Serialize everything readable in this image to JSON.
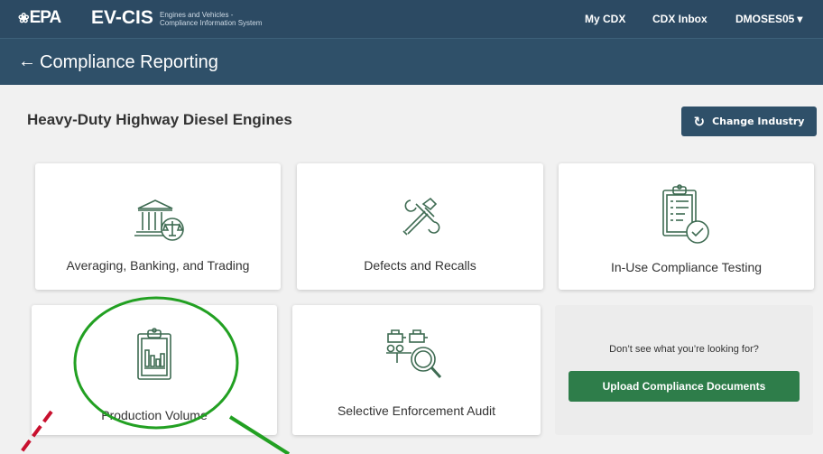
{
  "header": {
    "logo_text": "EPA",
    "logo_mark": "❀",
    "app_name": "EV-CIS",
    "app_subtitle_line1": "Engines and Vehicles -",
    "app_subtitle_line2": "Compliance Information System",
    "nav": {
      "my_cdx": "My CDX",
      "cdx_inbox": "CDX Inbox",
      "user": "DMOSES05",
      "user_caret": "▾"
    }
  },
  "title_bar": {
    "back_icon": "←",
    "title": "Compliance Reporting"
  },
  "section": {
    "title": "Heavy-Duty Highway Diesel Engines",
    "change_industry": {
      "icon": "↻",
      "label": "Change Industry"
    }
  },
  "cards": {
    "abt": {
      "label": "Averaging, Banking, and Trading",
      "icon": "bank-scale-icon"
    },
    "defects": {
      "label": "Defects and Recalls",
      "icon": "wrench-hammer-icon"
    },
    "in_use": {
      "label": "In-Use Compliance Testing",
      "icon": "clipboard-check-icon"
    },
    "production": {
      "label": "Production Volume",
      "icon": "clipboard-chart-icon"
    },
    "sea": {
      "label": "Selective Enforcement Audit",
      "icon": "engines-magnifier-icon"
    }
  },
  "help_card": {
    "question": "Don’t see what you’re looking for?",
    "upload_label": "Upload Compliance Documents"
  },
  "colors": {
    "header_bg": "#2c4a63",
    "title_bg": "#2f5069",
    "upload_green": "#2e7d4a",
    "annotation_green": "#22a022",
    "annotation_red": "#c8102e"
  }
}
